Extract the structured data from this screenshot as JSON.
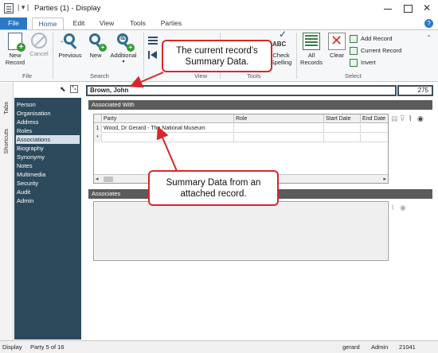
{
  "window": {
    "title": "Parties (1) - Display",
    "quick_access": "|  ▾  |"
  },
  "ribbon_tabs": [
    "File",
    "Home",
    "Edit",
    "View",
    "Tools",
    "Parties"
  ],
  "ribbon": {
    "file_group": {
      "new_record": "New\nRecord",
      "cancel": "Cancel",
      "label": "File"
    },
    "search_group": {
      "previous": "Previous",
      "new": "New",
      "additional": "Additional",
      "label": "Search"
    },
    "view_group": {
      "label": "View"
    },
    "tools_group": {
      "check_spelling": "Check\nSpelling",
      "abc": "ABC",
      "label": "Tools"
    },
    "select_group": {
      "all_records": "All\nRecords",
      "clear": "Clear",
      "add_record": "Add Record",
      "current_record": "Current Record",
      "invert": "Invert",
      "label": "Select"
    }
  },
  "sidebar": {
    "vertical_tabs": [
      "Tabs",
      "Shortcuts"
    ],
    "items": [
      "Person",
      "Organisation",
      "Address",
      "Roles",
      "Associations",
      "Biography",
      "Synonymy",
      "Notes",
      "Multimedia",
      "Security",
      "Audit",
      "Admin"
    ],
    "active_item": "Associations"
  },
  "record": {
    "summary": "Brown, John",
    "number": "275"
  },
  "associated_with": {
    "header": "Associated With",
    "columns": [
      "Party",
      "Role",
      "Start Date",
      "End Date"
    ],
    "rows": [
      {
        "num": "1",
        "party": "Wood, Dr Gerard - The National Museum",
        "role": "",
        "start": "",
        "end": ""
      }
    ],
    "new_row_marker": "*"
  },
  "associates": {
    "header": "Associates"
  },
  "callouts": {
    "current_record": "The current record's\nSummary Data.",
    "attached_record": "Summary Data from an\nattached record."
  },
  "status": {
    "mode": "Display",
    "position": "Party 5 of 16",
    "user": "gerard",
    "group": "Admin",
    "code": "21041"
  },
  "colors": {
    "accent": "#2b79c2",
    "nav_panel": "#2c4a5c",
    "callout_border": "#d9262b",
    "section_header": "#5b5b5b"
  }
}
